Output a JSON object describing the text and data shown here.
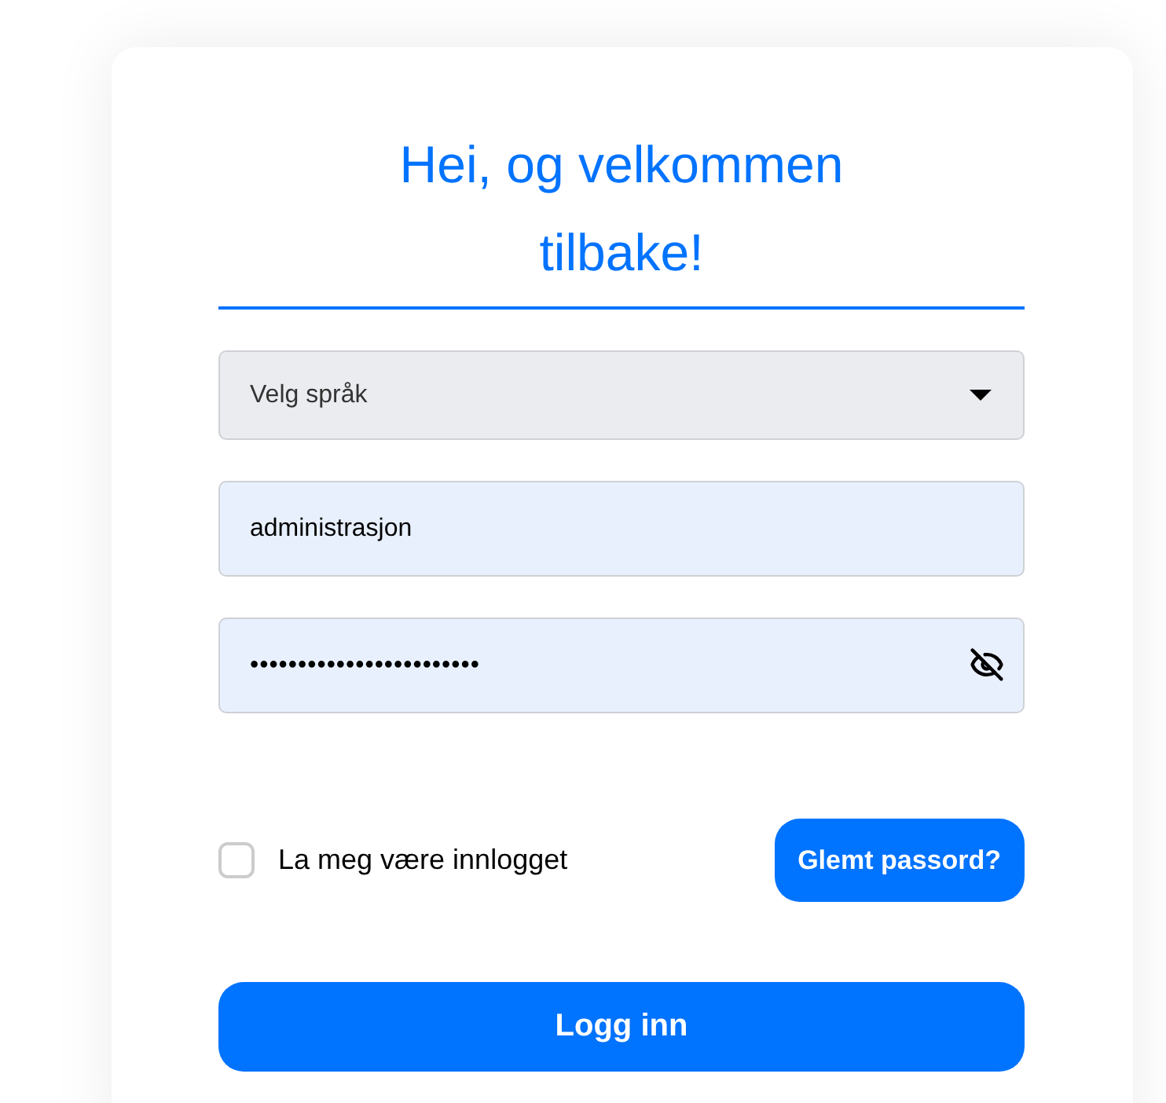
{
  "heading": "Hei, og velkommen tilbake!",
  "language_select": {
    "placeholder": "Velg språk"
  },
  "username": {
    "value": "administrasjon"
  },
  "password": {
    "value": "••••••••••••••••••••••••",
    "revealed": false
  },
  "remember_me": {
    "label": "La meg være innlogget",
    "checked": false
  },
  "forgot_password": {
    "label": "Glemt passord?"
  },
  "login_button": {
    "label": "Logg inn"
  }
}
